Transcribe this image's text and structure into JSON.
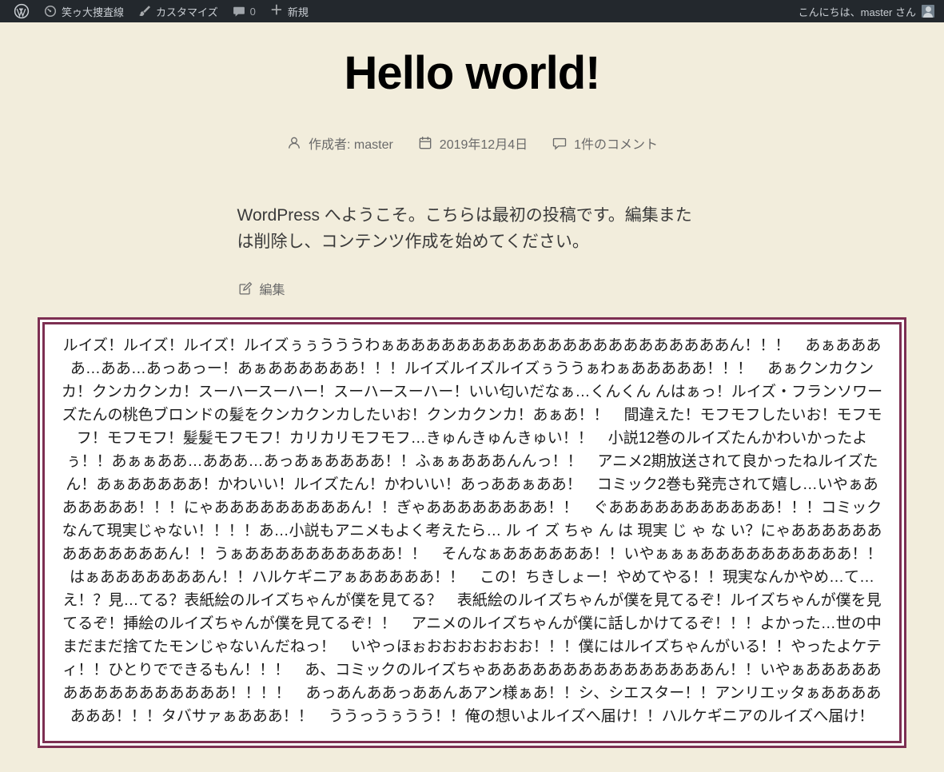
{
  "page": {
    "background": "#f2eddc"
  },
  "admin_bar": {
    "background": "#23282d",
    "text_color": "#c8cdd2",
    "site_name": "笑ゥ大捜査線",
    "customize_label": "カスタマイズ",
    "comment_count": "0",
    "new_label": "新規",
    "greeting": "こんにちは、master さん"
  },
  "post": {
    "title": "Hello world!",
    "author": "作成者: master",
    "date": "2019年12月4日",
    "comments": "1件のコメント",
    "body": "WordPress へようこそ。こちらは最初の投稿です。編集または削除し、コンテンツ作成を始めてください。",
    "edit_label": "編集"
  },
  "comment_box": {
    "border_color": "#7d2f52",
    "background": "#ffffff",
    "text": "ルイズ！ルイズ！ルイズ！ルイズぅぅうううわぁああああああああああああああああああああああん！！！　あぁああああ…ああ…あっあっー！あぁああああああ！！！ルイズルイズルイズぅううぁわぁあああああ！！！　あぁクンカクンカ！クンカクンカ！スーハースーハー！スーハースーハー！いい匂いだなぁ…くんくん んはぁっ！ルイズ・フランソワーズたんの桃色ブロンドの髪をクンカクンカしたいお！クンカクンカ！あぁあ！！　間違えた！モフモフしたいお！モフモフ！モフモフ！髪髪モフモフ！カリカリモフモフ…きゅんきゅんきゅい！！　小説12巻のルイズたんかわいかったよぅ！！あぁぁああ…あああ…あっあぁああああ！！ふぁぁあああんんっ！！　アニメ2期放送されて良かったねルイズたん！あぁあああああ！かわいい！ルイズたん！かわいい！あっああぁああ！　コミック2巻も発売されて嬉し…いやぁああああああ！！！にゃあああああああああん！！ぎゃああああああああ！！　ぐあああああああああああ！！！コミックなんて現実じゃない！！！！あ…小説もアニメもよく考えたら… ル イ ズ ちゃ ん は 現実 じ ゃ な い？にゃあああああああああああああん！！うぁああああああああああ！！　そんなぁああああああ！！いやぁぁぁああああああああああ！！はぁあああああああん！！ハルケギニアぁあああああ！！　この！ちきしょー！やめてやる！！現実なんかやめ…て…え！？見…てる？表紙絵のルイズちゃんが僕を見てる？　表紙絵のルイズちゃんが僕を見てるぞ！ルイズちゃんが僕を見てるぞ！挿絵のルイズちゃんが僕を見てるぞ！！　アニメのルイズちゃんが僕に話しかけてるぞ！！！よかった…世の中まだまだ捨てたモンじゃないんだねっ！　いやっほぉおおおおおおお！！！僕にはルイズちゃんがいる！！やったよケティ！！ひとりでできるもん！！！　あ、コミックのルイズちゃあああああああああああああああん！！いやぁああああああああああああああああ！！！！　あっあんああっああんあアン様ぁあ！！シ、シエスター！！アンリエッタぁあああああああ！！！タバサァぁあああ！！　ううっうぅうう！！俺の想いよルイズへ届け！！ハルケギニアのルイズへ届け！"
  }
}
